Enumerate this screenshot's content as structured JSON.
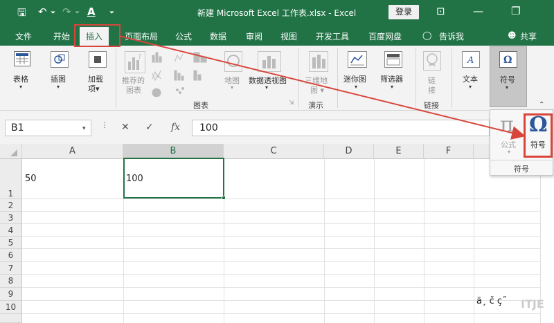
{
  "titlebar": {
    "title": "新建 Microsoft Excel 工作表.xlsx  -  Excel",
    "login": "登录",
    "save_glyph": "🖫",
    "undo_glyph": "↶",
    "redo_glyph": "↷",
    "font_color_glyph": "A",
    "qa_dropdown_glyph": "⏷",
    "ribbon_display_glyph": "⊡",
    "minimize_glyph": "—",
    "restore_glyph": "❐"
  },
  "menu": {
    "file": "文件",
    "home": "开始",
    "insert": "插入",
    "page_layout": "页面布局",
    "formulas": "公式",
    "data": "数据",
    "review": "审阅",
    "view": "视图",
    "developer": "开发工具",
    "baidu": "百度网盘",
    "tell_me": "告诉我",
    "share": "共享"
  },
  "ribbon": {
    "table": "表格",
    "illustrations": "插图",
    "addins_1": "加载",
    "addins_2": "项",
    "recommended_charts_1": "推荐的",
    "recommended_charts_2": "图表",
    "maps": "地图",
    "pivot_chart": "数据透视图",
    "map3d_1": "三维地",
    "map3d_2": "图",
    "sparklines": "迷你图",
    "filters": "筛选器",
    "link_1": "链",
    "link_2": "接",
    "text": "文本",
    "symbols": "符号",
    "group_charts": "图表",
    "group_tours": "演示",
    "group_links": "链接"
  },
  "formula_bar": {
    "name_box": "B1",
    "cancel_glyph": "✕",
    "enter_glyph": "✓",
    "fx_glyph": "fx",
    "value": "100"
  },
  "grid": {
    "columns": [
      "A",
      "B",
      "C",
      "D",
      "E",
      "F"
    ],
    "rows": [
      "1",
      "2",
      "3",
      "4",
      "5",
      "6",
      "7",
      "8",
      "9",
      "10"
    ],
    "cells": {
      "A1": "50",
      "B1": "100"
    }
  },
  "popup": {
    "equation_glyph": "π",
    "equation_label": "公式",
    "symbol_glyph": "Ω",
    "symbol_label": "符号",
    "group_label": "符号"
  },
  "watermark": {
    "text": "ä¸ č ç˝",
    "logo": "ITJE"
  },
  "colors": {
    "excel_green": "#217346",
    "highlight_red": "#d9453b",
    "symbol_blue": "#2b579a"
  }
}
